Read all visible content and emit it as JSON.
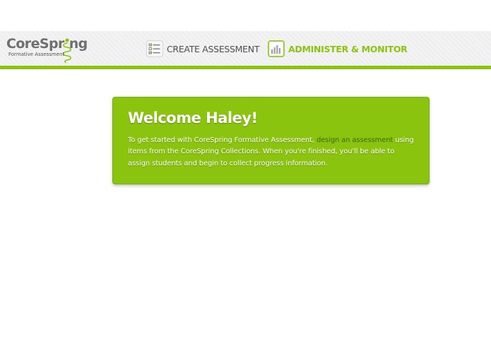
{
  "logo": {
    "name": "CoreSpring",
    "name_part1": "CoreSpr",
    "name_part2": "ng",
    "tagline": "Formative Assessment"
  },
  "nav": {
    "create_label": "CREATE ASSESSMENT",
    "create_icon": "checklist-icon",
    "admin_label": "ADMINISTER & MONITOR",
    "admin_icon": "bar-chart-icon",
    "active": "admin"
  },
  "welcome": {
    "title": "Welcome Haley!",
    "text_before": "To get started with CoreSpring Formative Assessment,",
    "link_text": "design an assessment",
    "text_after": "using items from the CoreSpring Collections. When you're finished, you'll be able to assign students and begin to collect progress information."
  },
  "colors": {
    "brand_green": "#8bc40f",
    "link_green": "#3e6a00",
    "logo_gray": "#6f6f6f"
  }
}
